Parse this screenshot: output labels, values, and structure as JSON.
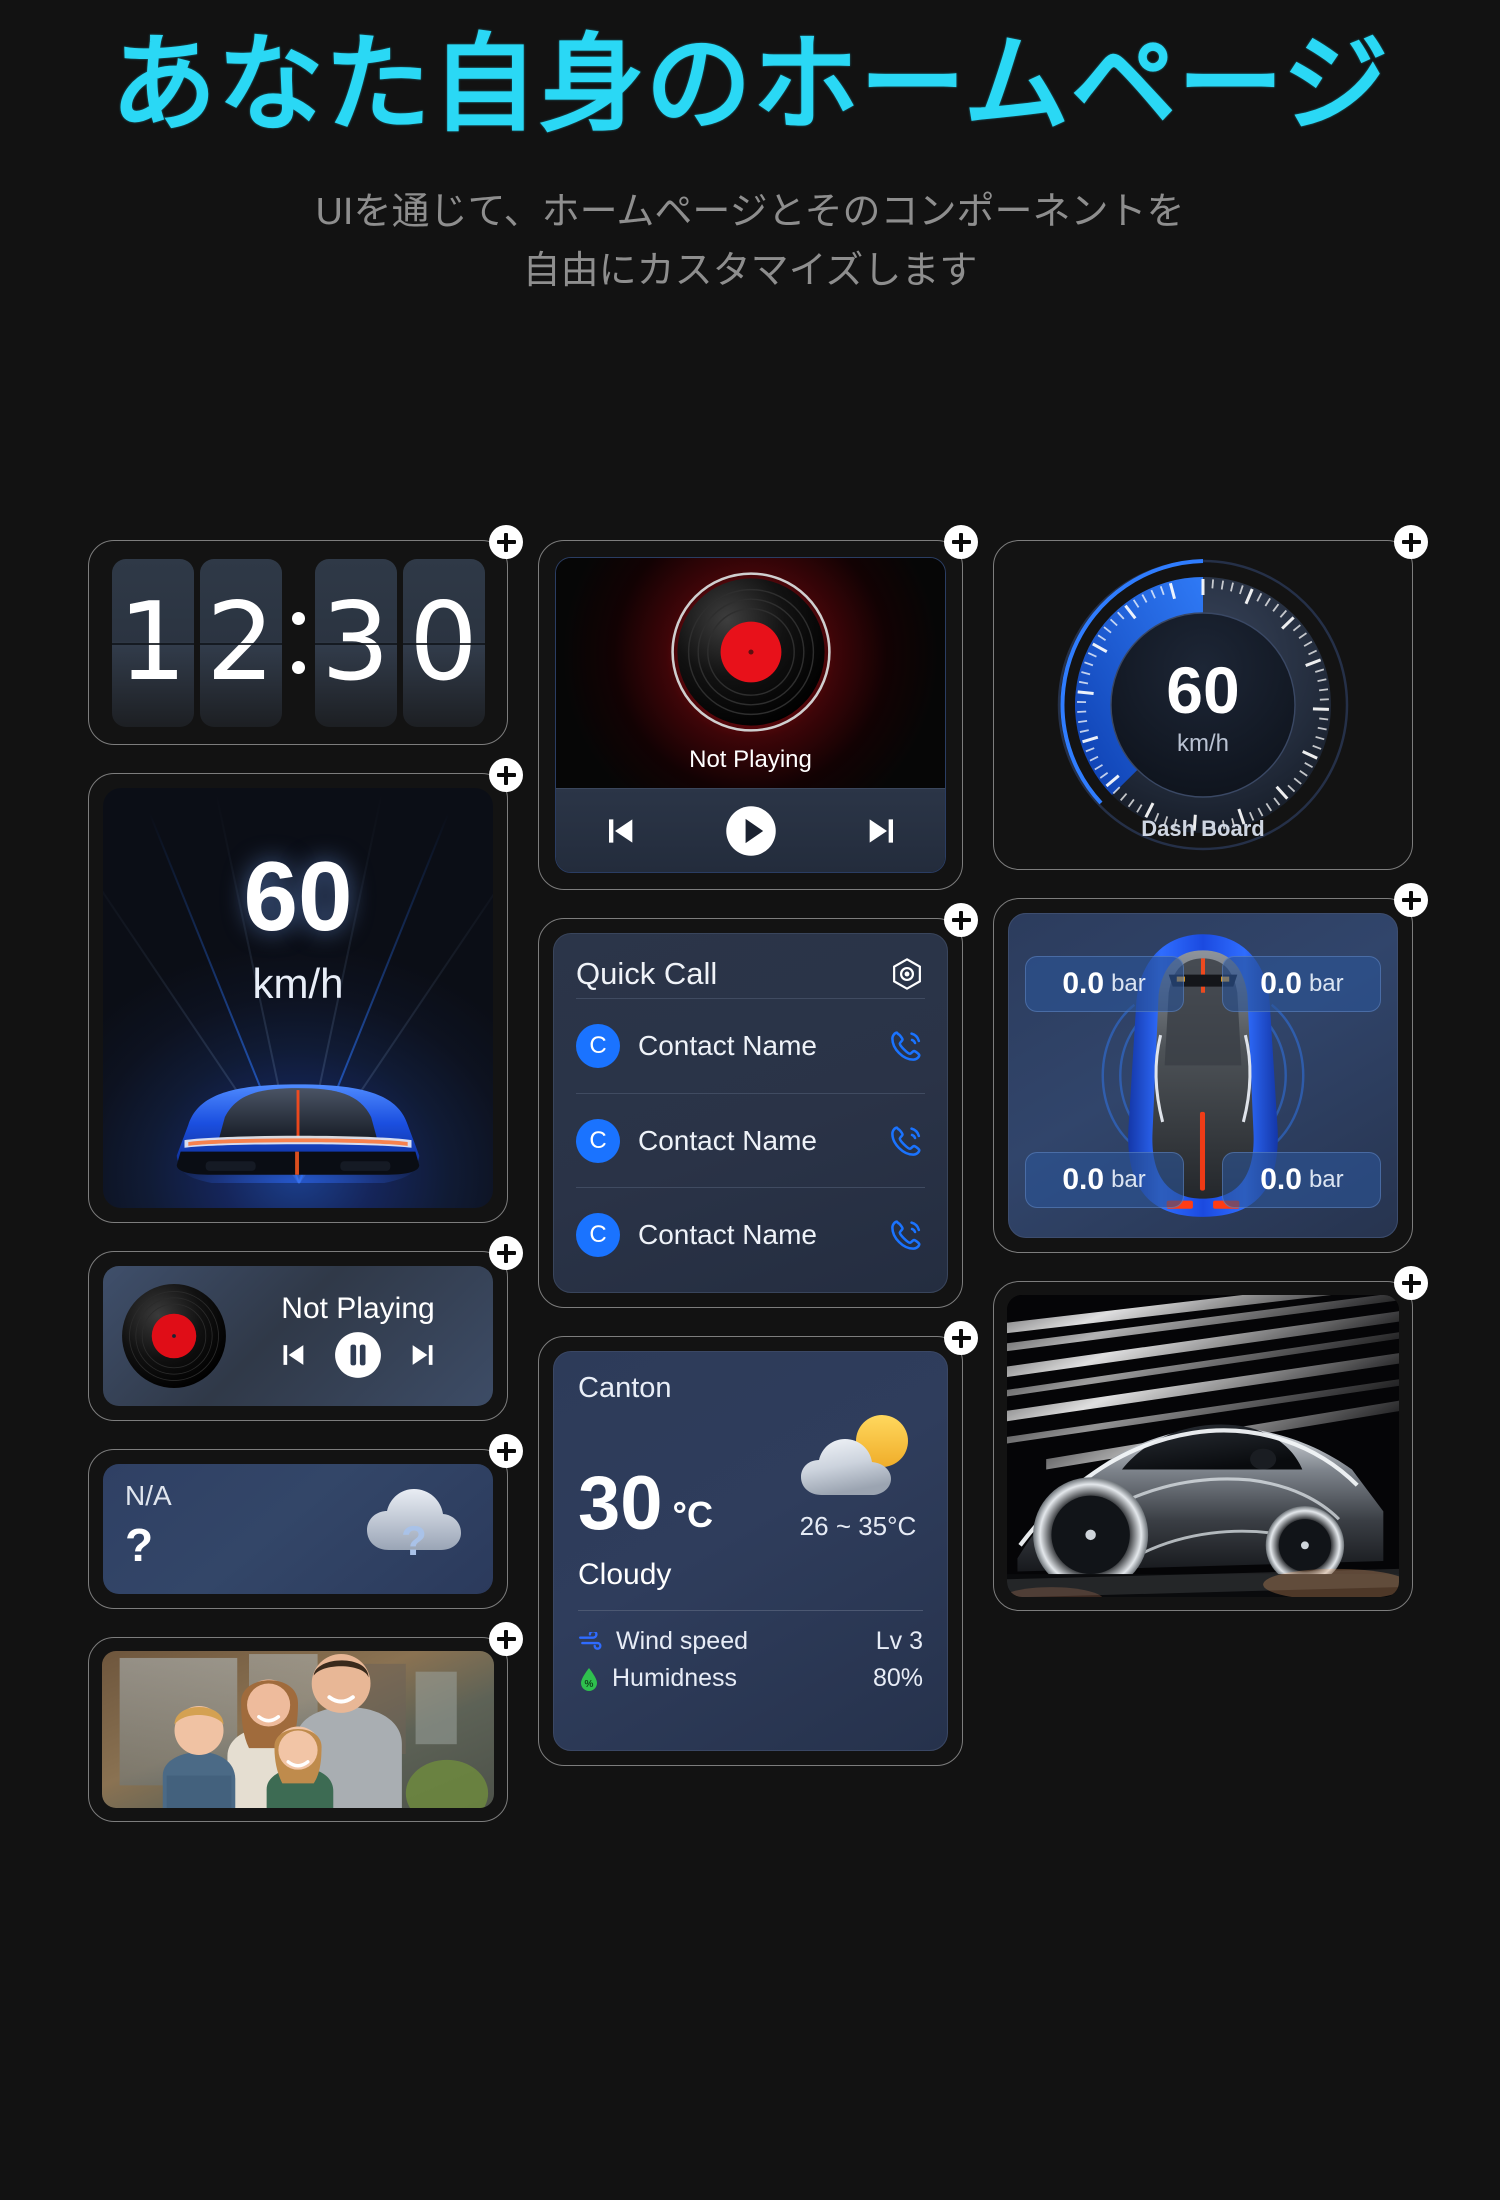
{
  "header": {
    "title": "あなた自身のホームページ",
    "subtitle_line1": "UIを通じて、ホームページとそのコンポーネントを",
    "subtitle_line2": "自由にカスタマイズします"
  },
  "colors": {
    "accent_cyan": "#2ad8f5",
    "background": "#121212",
    "card_border": "#7d7d7d",
    "blue_accent": "#1a73ff",
    "record_red": "#e00d17",
    "widget_blue": "#2f3d5c"
  },
  "widgets": {
    "clock": {
      "name": "Flip Clock",
      "digits": [
        "1",
        "2",
        "3",
        "0"
      ],
      "time": "12:30",
      "add_icon": "plus-icon"
    },
    "hud_speed": {
      "name": "HUD Speed",
      "value": "60",
      "unit": "km/h",
      "add_icon": "plus-icon"
    },
    "mini_music": {
      "name": "Mini Music Player",
      "status": "Not Playing",
      "prev_icon": "skip-previous-icon",
      "play_icon": "pause-icon",
      "next_icon": "skip-next-icon",
      "add_icon": "plus-icon"
    },
    "na_weather": {
      "name": "Weather Unavailable",
      "label": "N/A",
      "value": "?",
      "icon": "cloud-question-icon",
      "add_icon": "plus-icon"
    },
    "photo": {
      "name": "Family Photo",
      "add_icon": "plus-icon"
    },
    "music": {
      "name": "Music Player",
      "status": "Not Playing",
      "prev_icon": "skip-previous-icon",
      "play_icon": "play-icon",
      "next_icon": "skip-next-icon",
      "add_icon": "plus-icon"
    },
    "quick_call": {
      "name": "Quick Call",
      "title": "Quick Call",
      "settings_icon": "hexagon-settings-icon",
      "contacts": [
        {
          "initial": "C",
          "name": "Contact Name",
          "call_icon": "phone-ring-icon"
        },
        {
          "initial": "C",
          "name": "Contact Name",
          "call_icon": "phone-ring-icon"
        },
        {
          "initial": "C",
          "name": "Contact Name",
          "call_icon": "phone-ring-icon"
        }
      ],
      "add_icon": "plus-icon"
    },
    "weather": {
      "name": "Weather",
      "city": "Canton",
      "temperature": "30",
      "unit": "°C",
      "range": "26 ~ 35°C",
      "condition": "Cloudy",
      "icon": "sun-behind-cloud-icon",
      "stats": [
        {
          "icon": "wind-icon",
          "label": "Wind speed",
          "value": "Lv 3"
        },
        {
          "icon": "humidity-droplet-icon",
          "label": "Humidness",
          "value": "80%"
        }
      ],
      "add_icon": "plus-icon"
    },
    "dashboard": {
      "name": "Dash Board Gauge",
      "value": "60",
      "unit": "km/h",
      "label": "Dash Board",
      "add_icon": "plus-icon"
    },
    "tpms": {
      "name": "Tire Pressure",
      "tires": [
        {
          "position": "front-left",
          "value": "0.0",
          "unit": "bar"
        },
        {
          "position": "front-right",
          "value": "0.0",
          "unit": "bar"
        },
        {
          "position": "rear-left",
          "value": "0.0",
          "unit": "bar"
        },
        {
          "position": "rear-right",
          "value": "0.0",
          "unit": "bar"
        }
      ],
      "add_icon": "plus-icon"
    },
    "hero_car": {
      "name": "Car Wallpaper",
      "add_icon": "plus-icon"
    }
  }
}
